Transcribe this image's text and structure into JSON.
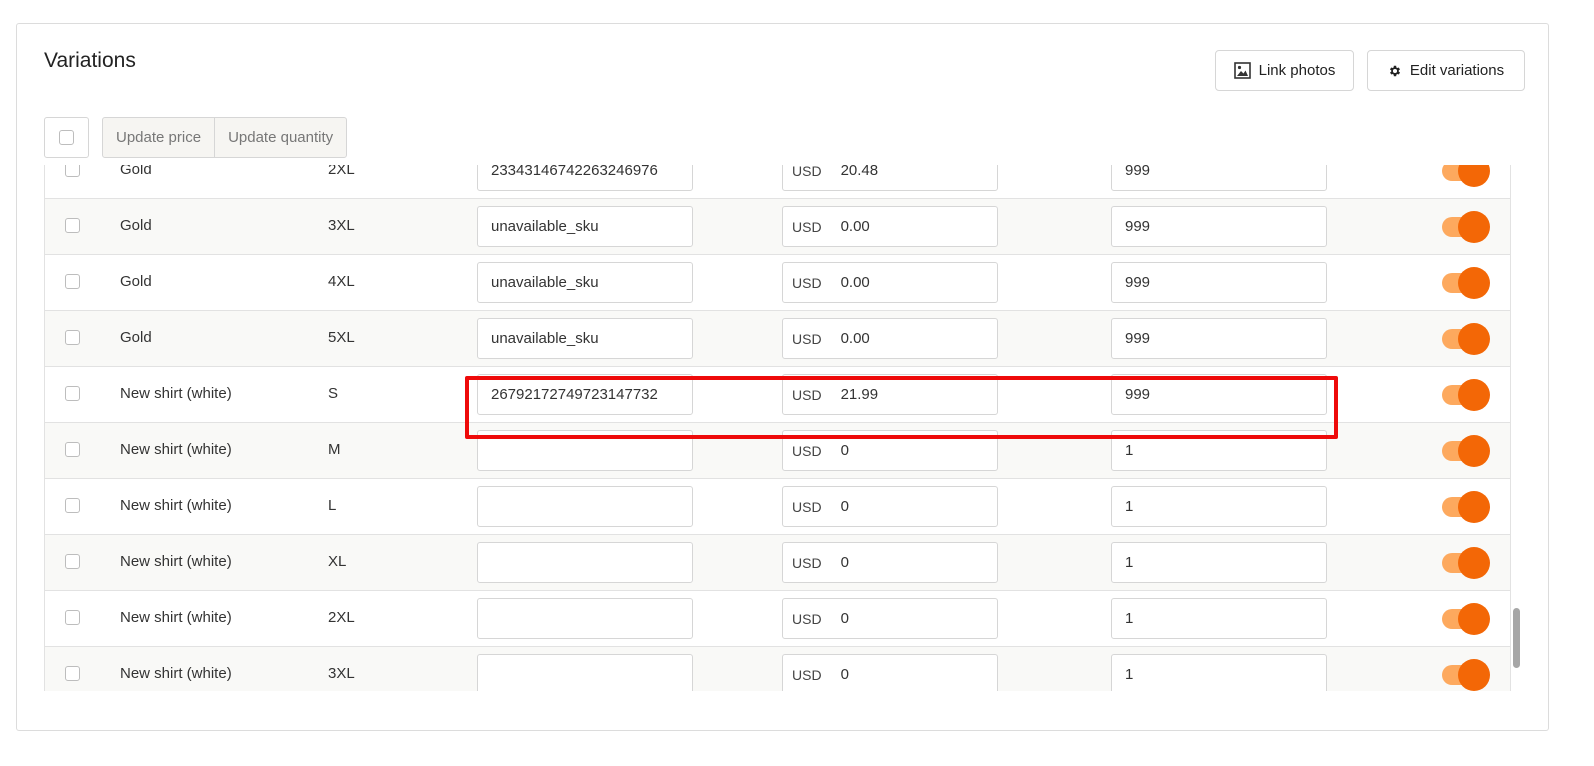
{
  "section": {
    "title": "Variations",
    "link_photos_label": "Link photos",
    "edit_variations_label": "Edit variations"
  },
  "bulk": {
    "update_price_label": "Update price",
    "update_quantity_label": "Update quantity"
  },
  "colors": {
    "toggle_on": "#f36706",
    "toggle_track": "#fda95e",
    "highlight": "#ee0a0a"
  },
  "rows": [
    {
      "name": "Gold",
      "size": "2XL",
      "sku": "23343146742263246976",
      "currency": "USD",
      "price": "20.48",
      "quantity": "999",
      "enabled": true
    },
    {
      "name": "Gold",
      "size": "3XL",
      "sku": "unavailable_sku",
      "currency": "USD",
      "price": "0.00",
      "quantity": "999",
      "enabled": true
    },
    {
      "name": "Gold",
      "size": "4XL",
      "sku": "unavailable_sku",
      "currency": "USD",
      "price": "0.00",
      "quantity": "999",
      "enabled": true
    },
    {
      "name": "Gold",
      "size": "5XL",
      "sku": "unavailable_sku",
      "currency": "USD",
      "price": "0.00",
      "quantity": "999",
      "enabled": true
    },
    {
      "name": "New shirt (white)",
      "size": "S",
      "sku": "26792172749723147732",
      "currency": "USD",
      "price": "21.99",
      "quantity": "999",
      "enabled": true,
      "highlighted": true
    },
    {
      "name": "New shirt (white)",
      "size": "M",
      "sku": "",
      "currency": "USD",
      "price": "0",
      "quantity": "1",
      "enabled": true
    },
    {
      "name": "New shirt (white)",
      "size": "L",
      "sku": "",
      "currency": "USD",
      "price": "0",
      "quantity": "1",
      "enabled": true
    },
    {
      "name": "New shirt (white)",
      "size": "XL",
      "sku": "",
      "currency": "USD",
      "price": "0",
      "quantity": "1",
      "enabled": true
    },
    {
      "name": "New shirt (white)",
      "size": "2XL",
      "sku": "",
      "currency": "USD",
      "price": "0",
      "quantity": "1",
      "enabled": true
    },
    {
      "name": "New shirt (white)",
      "size": "3XL",
      "sku": "",
      "currency": "USD",
      "price": "0",
      "quantity": "1",
      "enabled": true
    }
  ]
}
